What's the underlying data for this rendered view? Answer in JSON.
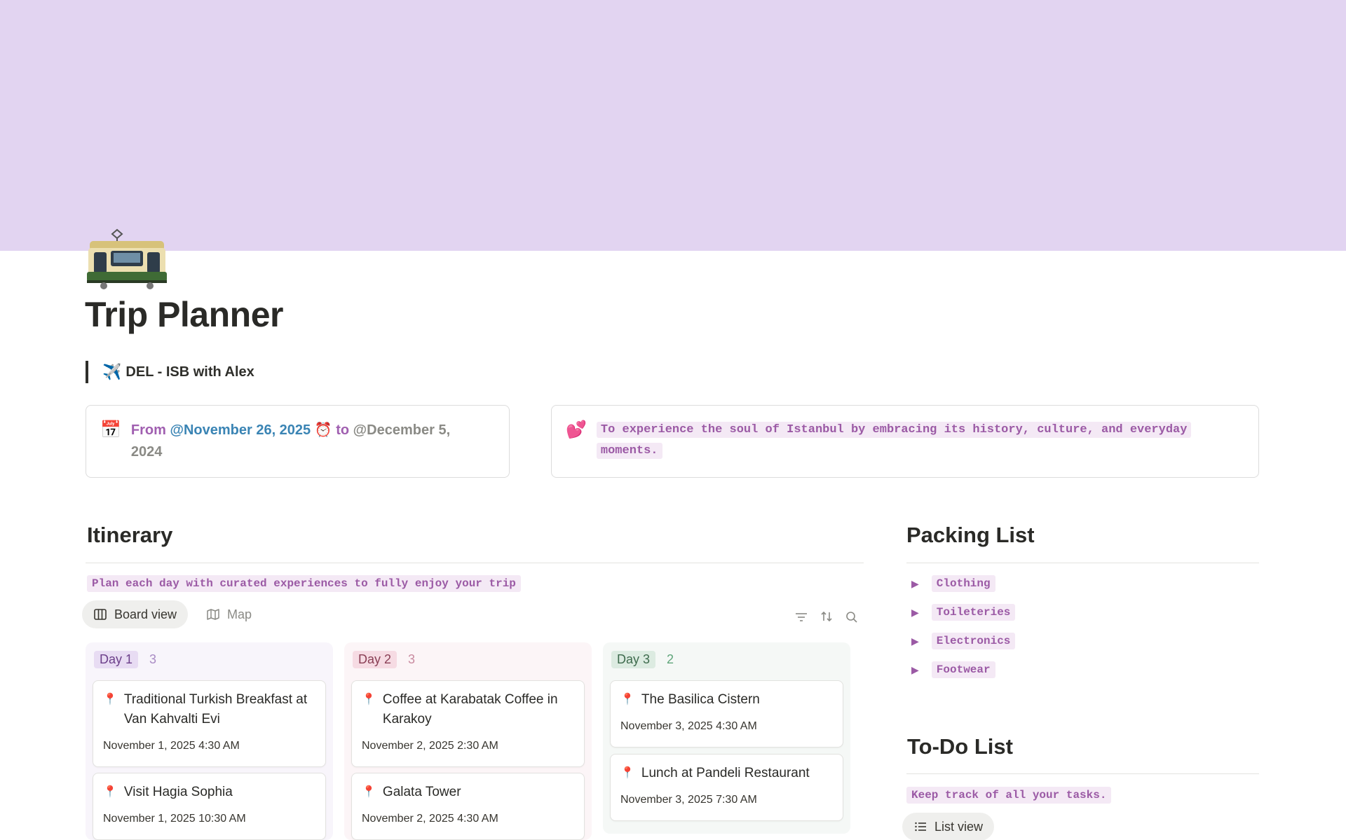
{
  "page": {
    "title": "Trip Planner",
    "icon": "tram-icon",
    "cover_color": "#e2d4f1"
  },
  "quote": {
    "emoji": "✈️",
    "text": "DEL - ISB with Alex"
  },
  "dates_callout": {
    "emoji": "📅",
    "from_label": "From",
    "from_date": "@November 26, 2025",
    "alarm": "⏰",
    "to_label": "to",
    "to_date": "@December 5,",
    "to_year": "2024"
  },
  "goal_callout": {
    "emoji": "💕",
    "text": "To experience the soul of Istanbul by embracing its history, culture, and everyday moments."
  },
  "itinerary": {
    "title": "Itinerary",
    "description": "Plan each day with curated experiences to fully enjoy your trip",
    "views": [
      {
        "label": "Board view",
        "icon": "board-icon",
        "active": true
      },
      {
        "label": "Map",
        "icon": "map-icon",
        "active": false
      }
    ],
    "columns": [
      {
        "label": "Day 1",
        "count": "3",
        "tag_color": "#e8dcf3",
        "text_color": "#6c3f8a",
        "count_color": "#a98bc4",
        "bg": "#f8f5fb",
        "cards": [
          {
            "title": "Traditional Turkish Breakfast at Van Kahvalti Evi",
            "date": "November 1, 2025 4:30 AM"
          },
          {
            "title": "Visit Hagia Sophia",
            "date": "November 1, 2025 10:30 AM"
          }
        ]
      },
      {
        "label": "Day 2",
        "count": "3",
        "tag_color": "#f6dbe3",
        "text_color": "#8a3f55",
        "count_color": "#c98ba0",
        "bg": "#fcf5f7",
        "cards": [
          {
            "title": "Coffee at Karabatak Coffee in Karakoy",
            "date": "November 2, 2025 2:30 AM"
          },
          {
            "title": "Galata Tower",
            "date": "November 2, 2025 4:30 AM"
          }
        ]
      },
      {
        "label": "Day 3",
        "count": "2",
        "tag_color": "#dcebe1",
        "text_color": "#3e6b4d",
        "count_color": "#5fa57a",
        "bg": "#f5f8f6",
        "cards": [
          {
            "title": "The Basilica Cistern",
            "date": "November 3, 2025 4:30 AM"
          },
          {
            "title": "Lunch at Pandeli Restaurant",
            "date": "November 3, 2025 7:30 AM"
          }
        ]
      }
    ]
  },
  "packing": {
    "title": "Packing List",
    "items": [
      "Clothing",
      "Toileteries",
      "Electronics",
      "Footwear"
    ]
  },
  "todo": {
    "title": "To-Do List",
    "description": "Keep track of all your tasks.",
    "view_label": "List view"
  }
}
